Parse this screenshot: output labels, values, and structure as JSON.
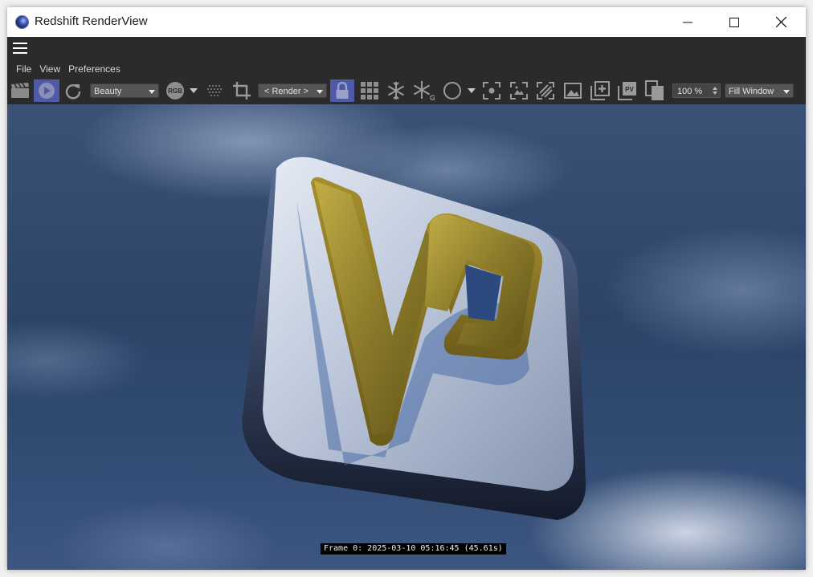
{
  "window": {
    "title": "Redshift RenderView",
    "controls": {
      "minimize": "minimize-icon",
      "maximize": "maximize-icon",
      "close": "close-icon"
    }
  },
  "menu": {
    "items": [
      "File",
      "View",
      "Preferences"
    ]
  },
  "toolbar": {
    "aov_select": "Beauty",
    "camera_select": "< Render >",
    "zoom": "100 %",
    "fit_select": "Fill Window",
    "icons": [
      "clapperboard-icon",
      "play-icon",
      "refresh-icon",
      "rgb-icon",
      "dither-icon",
      "crop-icon",
      "lock-icon",
      "grid-icon",
      "snowflake-icon",
      "snowflake-g-icon",
      "circle-icon",
      "focus-icon",
      "region-icon",
      "hatch-icon",
      "image-icon",
      "add-snapshot-icon",
      "pv-icon",
      "copy-icon"
    ],
    "rgb_label": "RGB",
    "pv_label": "PV",
    "g_label": "G"
  },
  "viewport": {
    "frame_info": "Frame 0: 2025-03-10 05:16:45 (45.61s)"
  },
  "colors": {
    "accent": "#4e5aa8",
    "toolbar_bg": "#2b2b2b",
    "logo_gold": "#8a7a2a",
    "tile_silver": "#b8c3d8"
  }
}
